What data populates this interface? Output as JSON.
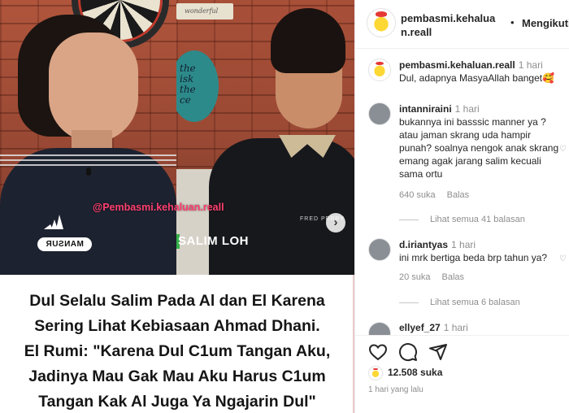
{
  "media": {
    "watermark": "@Pembasmi.kehaluan.reall",
    "name_tag_left": "MANSUR",
    "name_tag_right": "SALIM LOH",
    "badge_top": "wonderful",
    "poster_text": "the\nisk\nthe\nce",
    "fred_text": "FRED PERRY",
    "caption_lines": [
      "Dul Selalu Salim Pada Al dan El Karena",
      "Sering Lihat Kebiasaan Ahmad Dhani.",
      "El Rumi: \"Karena Dul C1um Tangan Aku,",
      "Jadinya Mau Gak Mau Aku Harus C1um",
      "Tangan Kak Al Juga Ya Ngajarin Dul\""
    ]
  },
  "header": {
    "username": "pembasmi.kehaluan.reall",
    "dot": "•",
    "follow_label": "Mengikuti"
  },
  "comments": [
    {
      "user": "pembasmi.kehaluan.reall",
      "time": "1 hari",
      "text": "Dul, adapnya MasyaAllah banget🥰"
    },
    {
      "user": "intanniraini",
      "time": "1 hari",
      "text": "bukannya ini basssic manner ya ? atau jaman skrang uda hampir punah? soalnya nengok anak skrang emang agak jarang salim kecuali sama ortu",
      "likes": "640 suka",
      "reply": "Balas",
      "view_replies": "Lihat semua 41 balasan"
    },
    {
      "user": "d.iriantyas",
      "time": "1 hari",
      "text": "ini mrk bertiga beda brp tahun ya?",
      "likes": "20 suka",
      "reply": "Balas",
      "view_replies": "Lihat semua 6 balasan"
    },
    {
      "user": "ellyef_27",
      "time": "1 hari"
    }
  ],
  "actions": {
    "icons": [
      "heart-icon",
      "comment-icon",
      "share-icon"
    ],
    "likes_count": "12.508 suka",
    "date": "1 hari yang lalu"
  },
  "colors": {
    "watermark": "#ff3f6f",
    "link_grey": "#8e8e8e",
    "text": "#262626",
    "name_bar": "#36b24a"
  }
}
